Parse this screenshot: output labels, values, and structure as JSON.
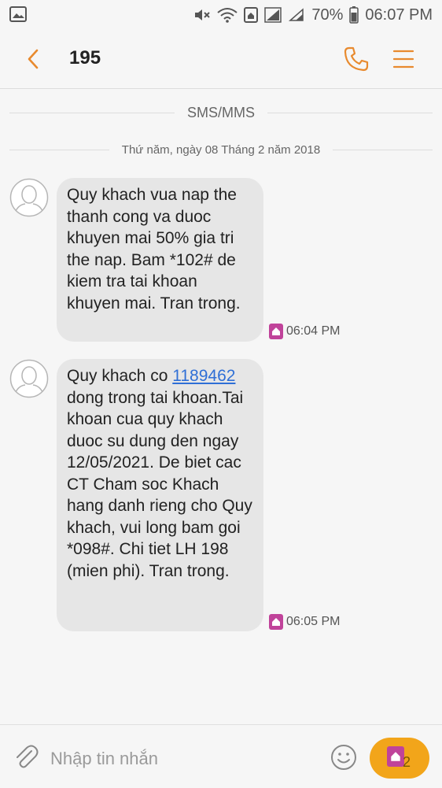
{
  "status_bar": {
    "battery_percent": "70%",
    "time": "06:07 PM",
    "icons": [
      "image-icon",
      "mute-icon",
      "wifi-icon",
      "home-sim-icon",
      "signal-icon",
      "signal-icon",
      "battery-icon"
    ]
  },
  "header": {
    "title": "195",
    "back_icon": "back-arrow-icon",
    "call_icon": "phone-icon",
    "menu_icon": "menu-icon"
  },
  "conversation": {
    "channel_label": "SMS/MMS",
    "date_label": "Thứ năm, ngày 08 Tháng 2 năm 2018",
    "messages": [
      {
        "text": "Quy khach vua nap the thanh cong va duoc khuyen mai 50% gia tri the nap. Bam *102# de kiem tra tai khoan khuyen mai. Tran trong.",
        "time": "06:04 PM"
      },
      {
        "text_before": "Quy khach co",
        "link": "1189462",
        "text_after": "dong trong tai khoan.Tai khoan cua quy khach duoc su dung den ngay 12/05/2021. De biet cac CT Cham soc Khach hang danh rieng cho Quy khach, vui long bam goi *098#. Chi tiet LH 198 (mien phi). Tran trong.",
        "time": "06:05 PM"
      }
    ]
  },
  "composer": {
    "placeholder": "Nhập tin nhắn",
    "send_sim_number": "2"
  },
  "colors": {
    "accent": "#f2a51a",
    "header_icons": "#e88a2e",
    "sim_badge": "#c0439a",
    "bubble": "#e6e6e6",
    "link": "#2f6fd6"
  }
}
